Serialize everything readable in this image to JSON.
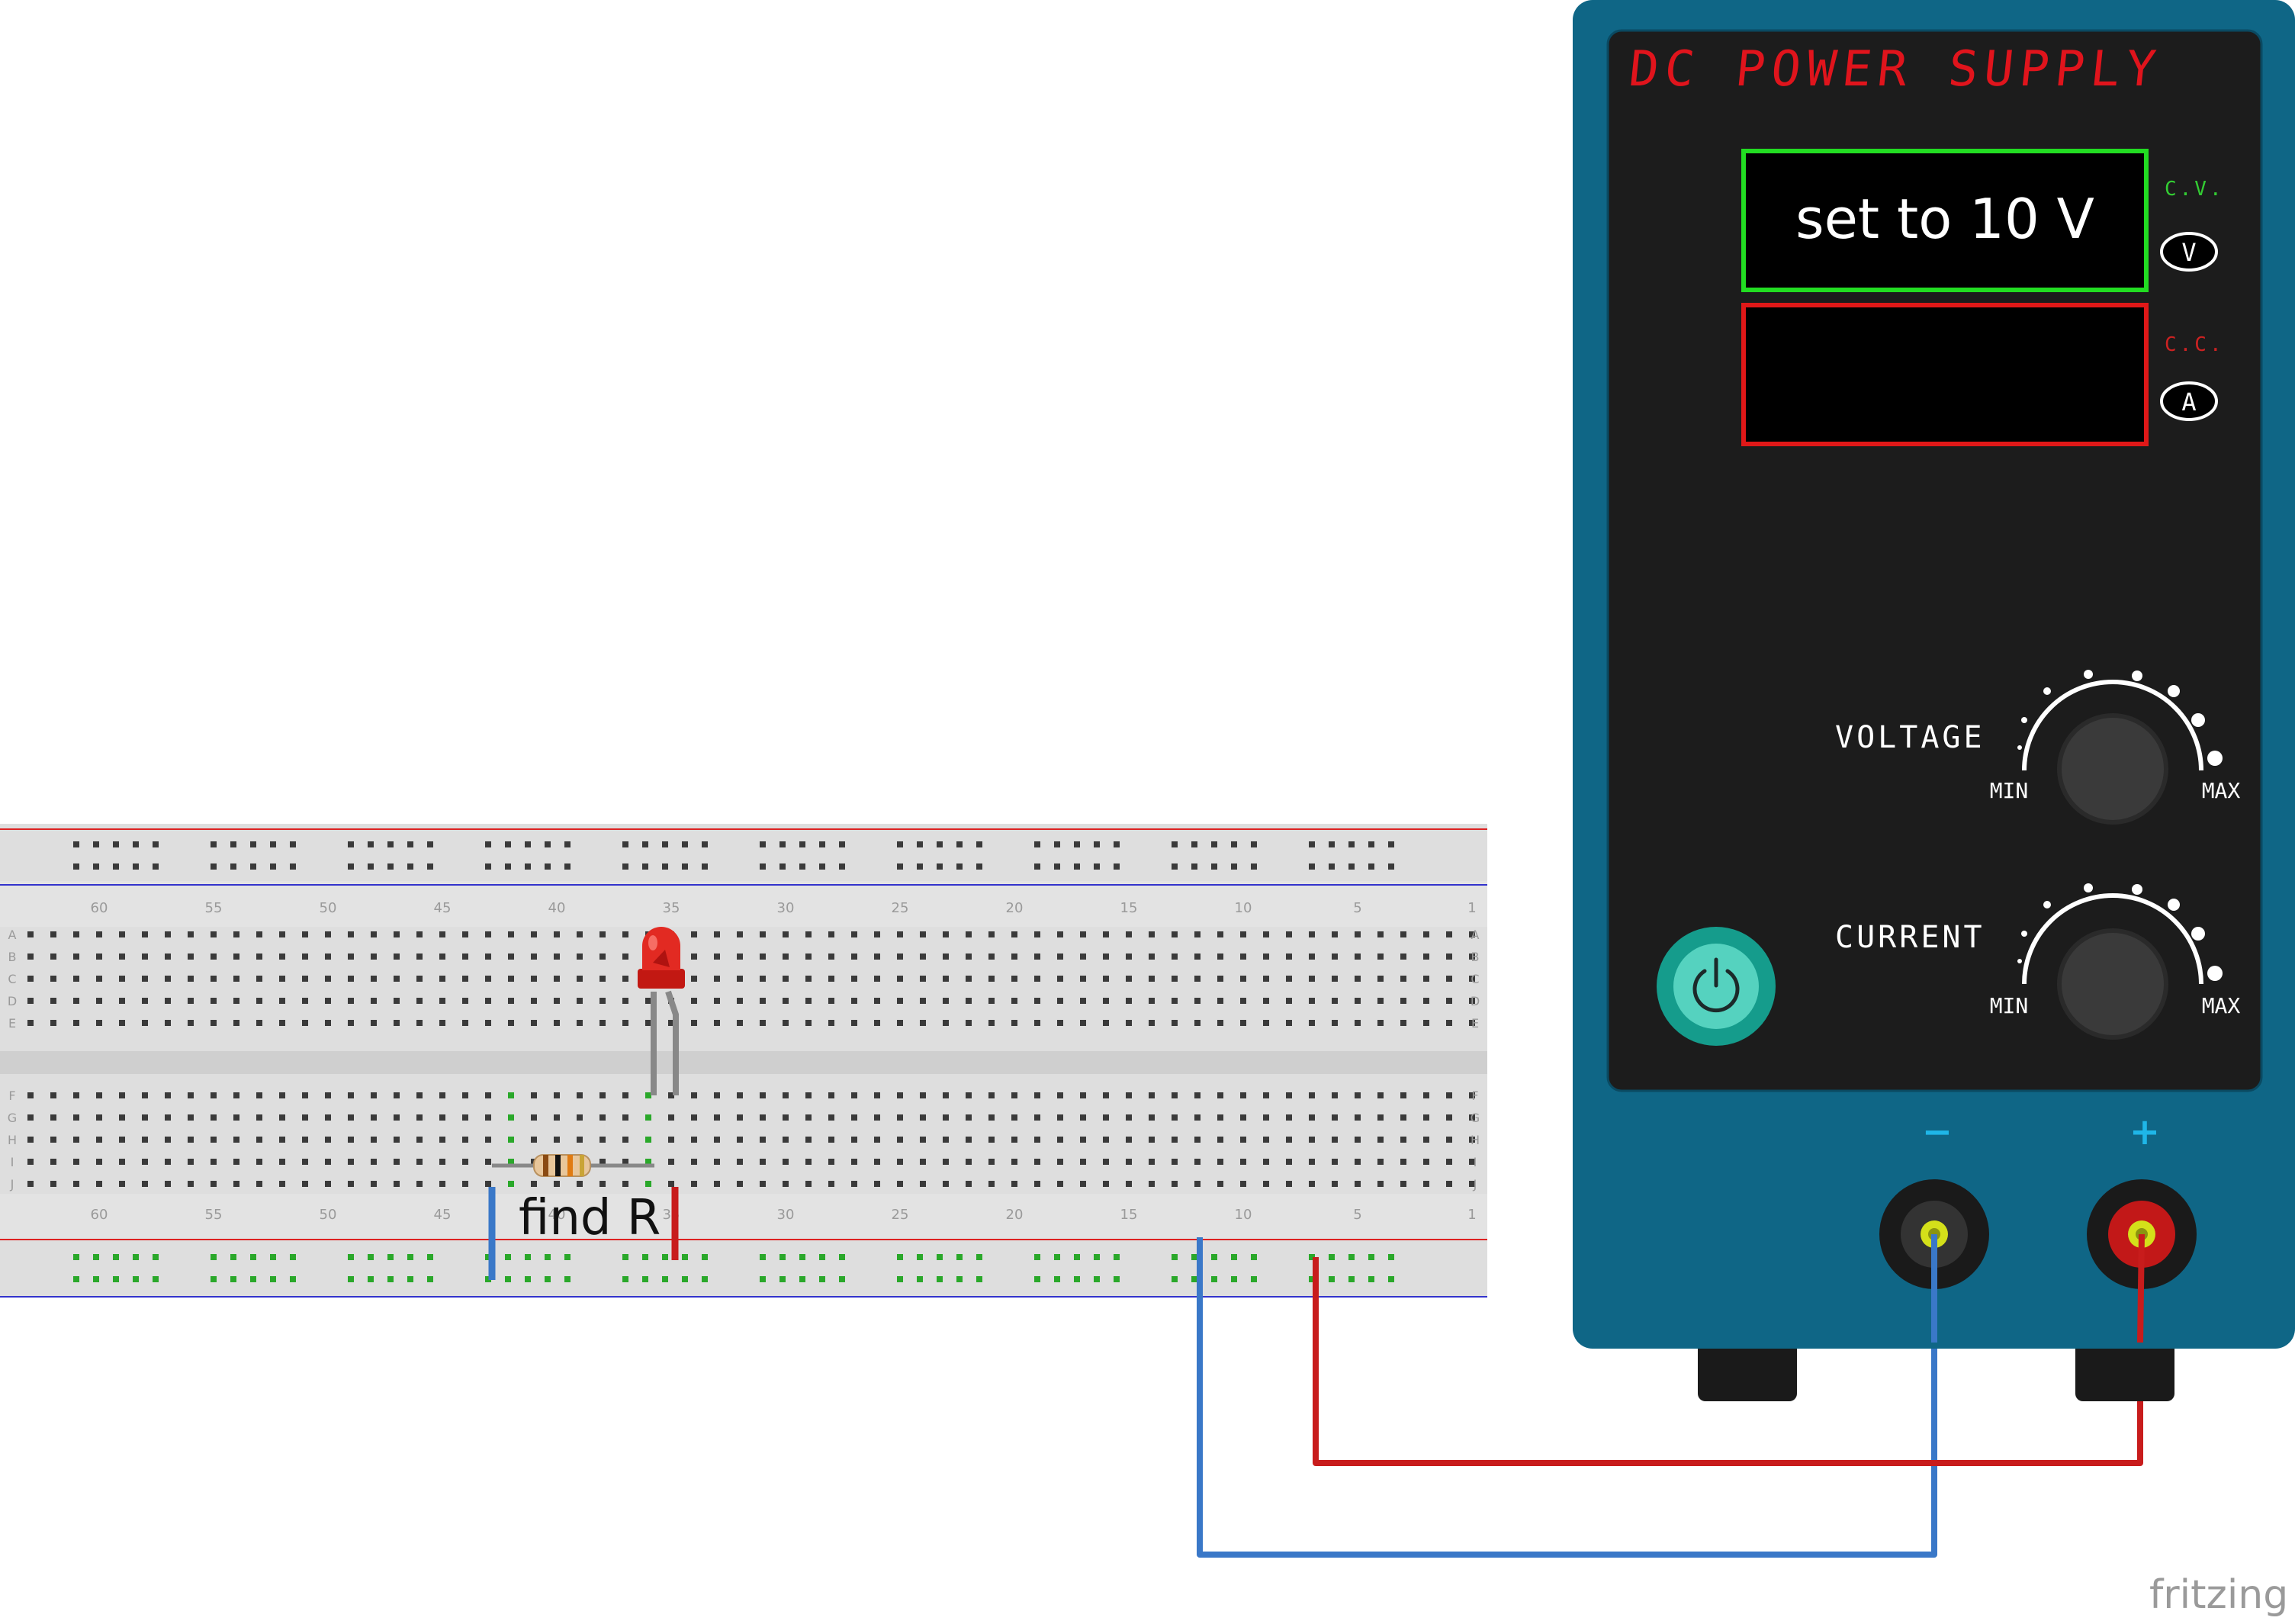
{
  "power_supply": {
    "title": "DC POWER SUPPLY",
    "voltage_display_text": "set to 10 V",
    "current_display_text": "",
    "cv_label": "C.V.",
    "cc_label": "C.C.",
    "v_button_label": "V",
    "a_button_label": "A",
    "voltage_knob_label": "VOLTAGE",
    "current_knob_label": "CURRENT",
    "min_label": "MIN",
    "max_label": "MAX",
    "minus_label": "−",
    "plus_label": "+",
    "colors": {
      "case": "#0f6686",
      "panel": "#1c1c1c",
      "title": "#e0141c",
      "voltage_frame": "#22dd22",
      "current_frame": "#e01818",
      "cv_text": "#33cc33",
      "cc_text": "#cc2222",
      "power_button": "#159c8c",
      "power_button_inner": "#55d2bf",
      "terminal_label": "#1fb6e8"
    },
    "icons": [
      "power-icon"
    ]
  },
  "breadboard": {
    "row_letters_top": [
      "A",
      "B",
      "C",
      "D",
      "E"
    ],
    "row_letters_bottom": [
      "F",
      "G",
      "H",
      "I",
      "J"
    ],
    "column_numbers": [
      "60",
      "55",
      "50",
      "45",
      "40",
      "35",
      "30",
      "25",
      "20",
      "15",
      "10",
      "5",
      "1"
    ]
  },
  "components": {
    "resistor_label": "find R",
    "led_color": "#e0201c"
  },
  "wires": {
    "negative_color": "#3a78c8",
    "positive_color": "#c81c1c"
  },
  "watermark": "fritzing"
}
